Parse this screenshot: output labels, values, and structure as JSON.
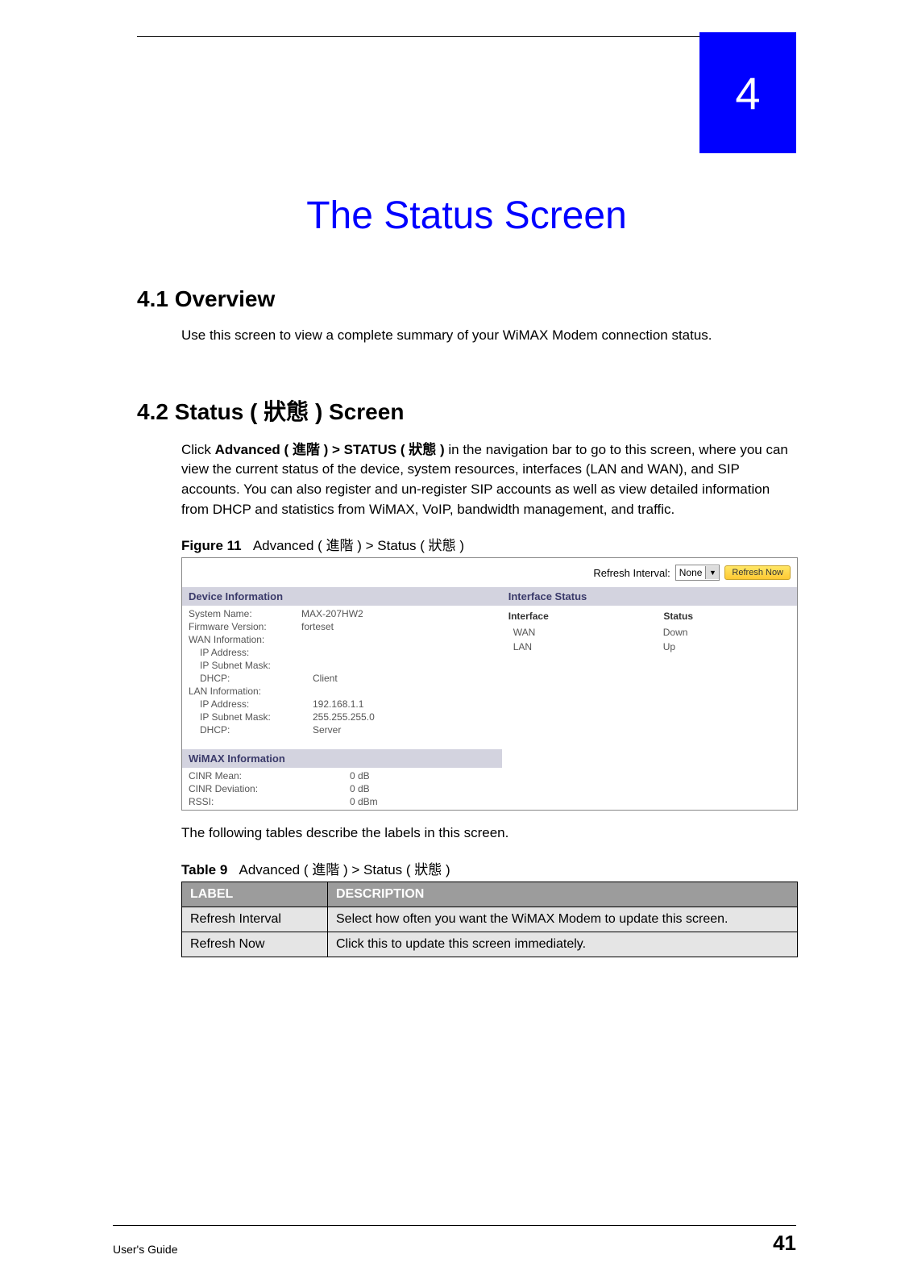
{
  "chapter": {
    "number": "4",
    "title": "The Status Screen"
  },
  "sections": {
    "overview": {
      "heading": "4.1  Overview",
      "body": "Use this screen to view a complete summary of your WiMAX Modem connection status."
    },
    "status": {
      "heading": "4.2  Status ( 狀態 ) Screen",
      "intro_pre": "Click ",
      "intro_bold": "Advanced ( 進階 ) > STATUS ( 狀態 )",
      "intro_post": " in the navigation bar to go to this screen, where you can view the current status of the device, system resources, interfaces (LAN and WAN), and SIP accounts. You can also register and un-register SIP accounts as well as view detailed information from DHCP and statistics from WiMAX, VoIP, bandwidth management, and traffic."
    }
  },
  "figure": {
    "label": "Figure 11",
    "caption": "Advanced ( 進階 ) > Status ( 狀態 )",
    "topbar": {
      "refresh_label": "Refresh Interval:",
      "dropdown_value": "None",
      "refresh_now": "Refresh Now"
    },
    "device_info": {
      "header": "Device Information",
      "rows": [
        {
          "k": "System Name:",
          "v": "MAX-207HW2",
          "indent": false
        },
        {
          "k": "Firmware Version:",
          "v": "forteset",
          "indent": false
        },
        {
          "k": "WAN Information:",
          "v": "",
          "indent": false
        },
        {
          "k": "IP Address:",
          "v": "",
          "indent": true
        },
        {
          "k": "IP Subnet Mask:",
          "v": "",
          "indent": true
        },
        {
          "k": "DHCP:",
          "v": "Client",
          "indent": true
        },
        {
          "k": "LAN Information:",
          "v": "",
          "indent": false
        },
        {
          "k": "IP Address:",
          "v": "192.168.1.1",
          "indent": true
        },
        {
          "k": "IP Subnet Mask:",
          "v": "255.255.255.0",
          "indent": true
        },
        {
          "k": "DHCP:",
          "v": "Server",
          "indent": true
        }
      ]
    },
    "wimax_info": {
      "header": "WiMAX Information",
      "rows": [
        {
          "k": "CINR Mean:",
          "v": "0 dB"
        },
        {
          "k": "CINR Deviation:",
          "v": "0 dB"
        },
        {
          "k": "RSSI:",
          "v": "0 dBm"
        }
      ]
    },
    "interface_status": {
      "header": "Interface Status",
      "col1": "Interface",
      "col2": "Status",
      "rows": [
        {
          "c1": "WAN",
          "c2": "Down"
        },
        {
          "c1": "LAN",
          "c2": "Up"
        }
      ]
    }
  },
  "post_figure_text": "The following tables describe the labels in this screen.",
  "table9": {
    "label": "Table 9",
    "caption": "Advanced ( 進階 ) > Status  ( 狀態 )",
    "header": {
      "c1": "LABEL",
      "c2": "DESCRIPTION"
    },
    "rows": [
      {
        "c1": "Refresh Interval",
        "c2": "Select how often you want the WiMAX Modem to update this screen."
      },
      {
        "c1": "Refresh Now",
        "c2": "Click this to update this screen immediately."
      }
    ]
  },
  "footer": {
    "guide": "User's Guide",
    "page": "41"
  }
}
